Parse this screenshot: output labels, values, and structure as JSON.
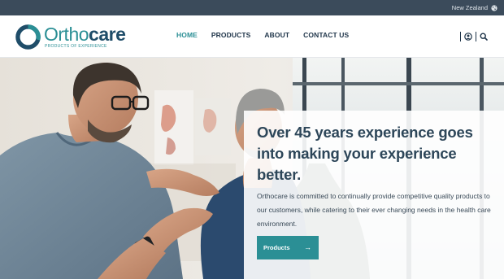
{
  "topbar": {
    "region": "New Zealand",
    "region_icon": "globe-icon"
  },
  "header": {
    "logo_word_primary": "Ortho",
    "logo_word_secondary": "care",
    "logo_tagline": "PRODUCTS OF EXPERIENCE",
    "icons": [
      "account-icon",
      "search-icon"
    ]
  },
  "nav": [
    {
      "label": "HOME",
      "active": true
    },
    {
      "label": "PRODUCTS",
      "active": false
    },
    {
      "label": "ABOUT",
      "active": false
    },
    {
      "label": "CONTACT US",
      "active": false
    }
  ],
  "hero": {
    "headline": "Over 45 years experience goes into making your experience better.",
    "description": "Orthocare is committed to continually provide competitive quality products to our customers, while catering to their ever changing needs in the health care environment.",
    "cta_label": "Products",
    "cta_icon": "arrow-right-icon"
  },
  "colors": {
    "topbar": "#3b4b5b",
    "accent": "#2b8f95",
    "nav_text": "#1d3348",
    "headline": "#2d4659"
  }
}
